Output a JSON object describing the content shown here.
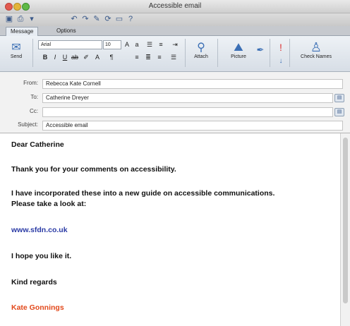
{
  "window": {
    "title": "Accessible email"
  },
  "ribbon": {
    "tabs": [
      "Message",
      "Options"
    ],
    "font_name": "Arial",
    "font_size": "10",
    "buttons": {
      "send": "Send",
      "attach": "Attach",
      "picture": "Picture",
      "check_names": "Check Names"
    }
  },
  "headers": {
    "from_label": "From:",
    "from_value": "Rebecca Kate Cornell",
    "to_label": "To:",
    "to_value": "Catherine Dreyer",
    "cc_label": "Cc:",
    "cc_value": "",
    "subject_label": "Subject:",
    "subject_value": "Accessible email"
  },
  "message": {
    "greeting": "Dear Catherine",
    "para1": "Thank you for your comments on accessibility.",
    "para2_line1": "I have incorporated these into a new guide on accessible communications.",
    "para2_line2": "Please take a look at:",
    "link": "www.sfdn.co.uk",
    "para3": "I hope you like it.",
    "closing": "Kind regards",
    "signature": "Kate Gonnings"
  },
  "colors": {
    "link": "#2a3aa5",
    "signature": "#e2481a",
    "body_text": "#111111"
  }
}
